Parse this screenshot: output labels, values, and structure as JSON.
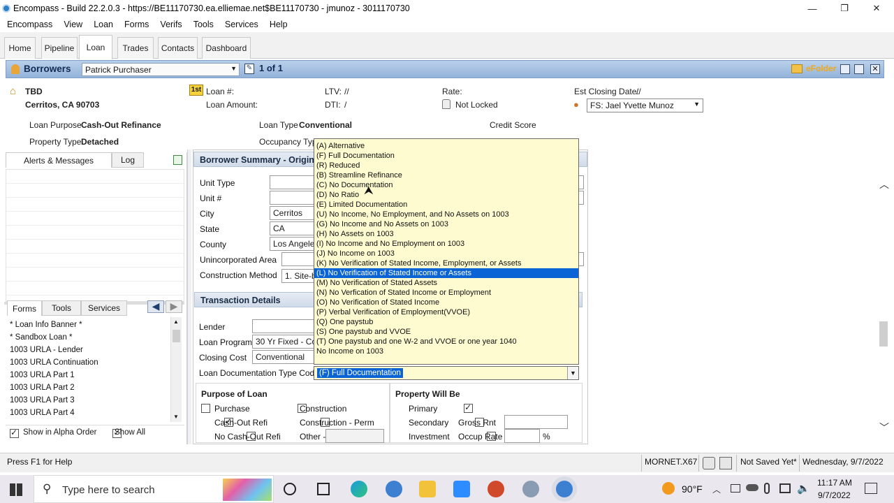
{
  "window": {
    "title": "Encompass - Build 22.2.0.3 - https://BE11170730.ea.elliemae.net$BE11170730 - jmunoz - 3011170730",
    "controls": [
      "—",
      "❐",
      "✕"
    ]
  },
  "menu": [
    "Encompass",
    "View",
    "Loan",
    "Forms",
    "Verifs",
    "Tools",
    "Services",
    "Help"
  ],
  "tabs": [
    "Home",
    "Pipeline",
    "Loan",
    "Trades",
    "Contacts",
    "Dashboard"
  ],
  "active_tab": "Loan",
  "borrower_bar": {
    "label": "Borrowers",
    "borrower": "Patrick Purchaser",
    "pager": "1 of 1",
    "efolder": "eFolder"
  },
  "loan_info": {
    "address1": "TBD",
    "address2": "Cerritos, CA 90703",
    "loan_num_label": "Loan #:",
    "loan_amount_label": "Loan Amount:",
    "ltv_label": "LTV:",
    "ltv_value": "//",
    "dti_label": "DTI:",
    "dti_value": "/",
    "rate_label": "Rate:",
    "lock_status": "Not Locked",
    "est_closing_label": "Est Closing Date:",
    "est_closing_value": "//",
    "fs_value": "FS: Jael Yvette Munoz",
    "loan_purpose_label": "Loan Purpose",
    "loan_purpose_value": "Cash-Out Refinance",
    "loan_type_label": "Loan Type",
    "loan_type_value": "Conventional",
    "credit_score_label": "Credit Score",
    "property_type_label": "Property Type",
    "property_type_value": "Detached",
    "occupancy_label": "Occupancy Type",
    "first_badge": "1st"
  },
  "left_panel": {
    "tabs": [
      "Alerts & Messages",
      "Log"
    ],
    "form_tabs": [
      "Forms",
      "Tools",
      "Services"
    ],
    "forms": [
      "* Loan Info Banner *",
      "* Sandbox Loan *",
      "1003 URLA - Lender",
      "1003 URLA Continuation",
      "1003 URLA Part 1",
      "1003 URLA Part 2",
      "1003 URLA Part 3",
      "1003 URLA Part 4"
    ],
    "show_alpha": "Show in Alpha Order",
    "show_all": "Show All"
  },
  "main_form": {
    "section_title": "Borrower Summary - Originati",
    "unit_type_label": "Unit Type",
    "unit_num_label": "Unit #",
    "city_label": "City",
    "city_value": "Cerritos",
    "state_label": "State",
    "state_value": "CA",
    "county_label": "County",
    "county_value": "Los Angeles",
    "unincorporated_label": "Unincorporated Area",
    "construction_method_label": "Construction Method",
    "construction_method_value": "1. Site-bu",
    "transaction_title": "Transaction Details",
    "lender_label": "Lender",
    "loan_program_label": "Loan Program",
    "loan_program_value": "30 Yr Fixed - Con",
    "closing_cost_label": "Closing Cost",
    "closing_cost_value": "Conventional",
    "doc_type_label": "Loan Documentation Type Code",
    "doc_type_value": "(F) Full Documentation",
    "purpose_title": "Purpose of Loan",
    "purpose_options": [
      {
        "label": "Purchase",
        "checked": false
      },
      {
        "label": "Construction",
        "checked": false
      },
      {
        "label": "Cash-Out Refi",
        "checked": true
      },
      {
        "label": "Construction - Perm",
        "checked": false
      },
      {
        "label": "No Cash-Out Refi",
        "checked": false
      },
      {
        "label": "Other -",
        "checked": false
      }
    ],
    "property_title": "Property Will Be",
    "property_options": [
      {
        "label": "Primary",
        "checked": true
      },
      {
        "label": "Secondary",
        "checked": false
      },
      {
        "label": "Investment",
        "checked": false
      }
    ],
    "gross_rnt_label": "Gross Rnt",
    "occup_rate_label": "Occup Rate",
    "percent": "%"
  },
  "dropdown_options": [
    "(A) Alternative",
    "(F) Full Documentation",
    "(R) Reduced",
    "(B) Streamline Refinance",
    "(C) No Documentation",
    "(D) No Ratio",
    "(E) Limited Documentation",
    "(U) No Income, No Employment, and No Assets on 1003",
    "(G) No Income and No Assets on 1003",
    "(H) No Assets on 1003",
    "(I) No Income and No Employment on 1003",
    "(J) No Income on 1003",
    "(K) No Verification of Stated Income, Employment, or Assets",
    "(L) No Verification of Stated Income or Assets",
    "(M) No Verification of Stated Assets",
    "(N) No Verfication of Stated Income or Employment",
    "(O) No Verification of Stated Income",
    "(P) Verbal Verification of Employment(VVOE)",
    "(Q) One paystub",
    "(S) One paystub and VVOE",
    "(T) One paystub and one W-2 and VVOE or one year 1040",
    "No Income on 1003"
  ],
  "dropdown_highlighted": "(L) No Verification of Stated Income or Assets",
  "status_bar": {
    "help": "Press F1 for Help",
    "server": "MORNET.X67",
    "save_state": "Not Saved Yet*",
    "date": "Wednesday, 9/7/2022"
  },
  "taskbar": {
    "search_placeholder": "Type here to search",
    "temperature": "90°F",
    "time": "11:17 AM",
    "date": "9/7/2022"
  },
  "colors": {
    "accent_blue": "#0a64d6",
    "header_blue": "#93b3d9",
    "dropdown_bg": "#fffbd0",
    "efolder_orange": "#f2a817"
  }
}
